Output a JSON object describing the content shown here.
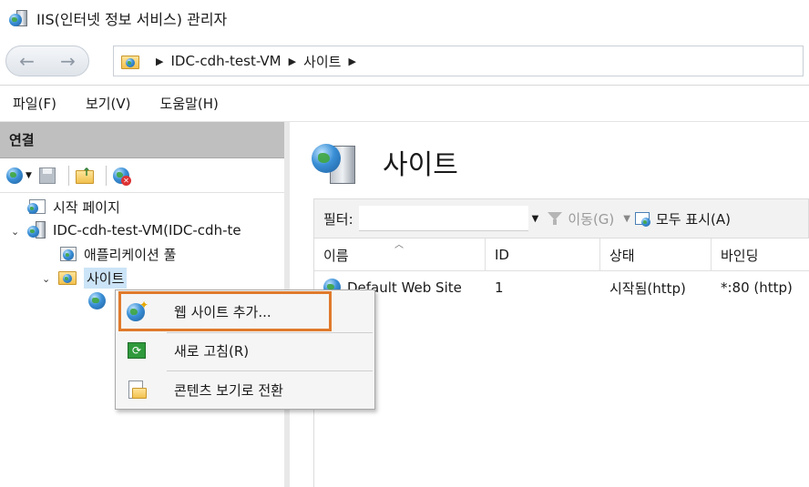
{
  "window": {
    "title": "IIS(인터넷 정보 서비스) 관리자"
  },
  "address": {
    "back": "←",
    "forward": "→",
    "crumbs": [
      "IDC-cdh-test-VM",
      "사이트"
    ]
  },
  "menu": {
    "file": "파일(F)",
    "view": "보기(V)",
    "help": "도움말(H)"
  },
  "connections": {
    "header": "연결",
    "tree": {
      "start_page": "시작 페이지",
      "server": "IDC-cdh-test-VM(IDC-cdh-te",
      "app_pools": "애플리케이션 풀",
      "sites": "사이트"
    }
  },
  "main": {
    "title": "사이트",
    "filter": {
      "label": "필터:",
      "value": "",
      "go": "이동(G)",
      "show_all": "모두 표시(A)"
    },
    "columns": {
      "name": "이름",
      "id": "ID",
      "status": "상태",
      "binding": "바인딩"
    },
    "rows": [
      {
        "name": "Default Web Site",
        "id": "1",
        "status": "시작됨(http)",
        "binding": "*:80 (http)"
      }
    ]
  },
  "context_menu": {
    "add_site": "웹 사이트 추가...",
    "refresh": "새로 고침(R)",
    "content_view": "콘텐츠 보기로 전환"
  }
}
